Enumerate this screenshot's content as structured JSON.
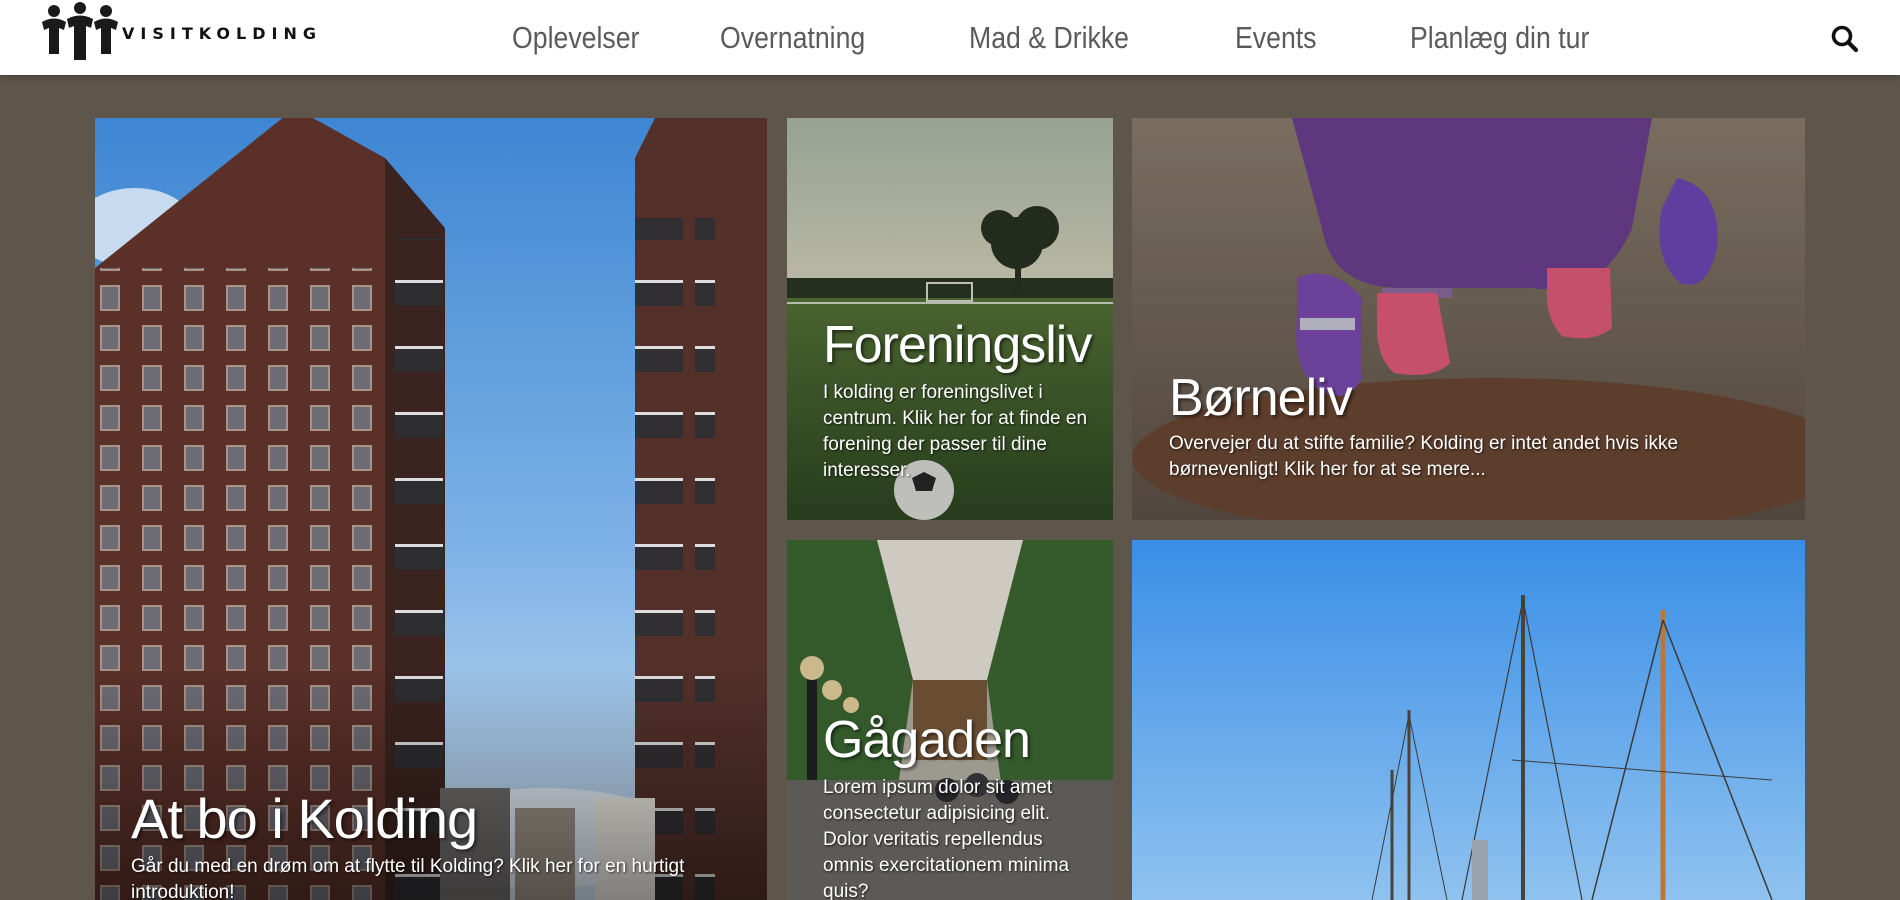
{
  "header": {
    "logo_text": "VISITKOLDING",
    "nav": [
      "Oplevelser",
      "Overnatning",
      "Mad & Drikke",
      "Events",
      "Planlæg din tur"
    ],
    "search_icon": "search-icon"
  },
  "tiles": {
    "bo": {
      "title": "At bo i Kolding",
      "text": "Går du med en drøm om at flytte til Kolding? Klik her for en hurtigt introduktion!"
    },
    "forening": {
      "title": "Foreningsliv",
      "text": "I kolding er foreningslivet i centrum. Klik her for at finde en forening der passer til dine interesser."
    },
    "born": {
      "title": "Børneliv",
      "text": "Overvejer du at stifte familie? Kolding er intet andet hvis ikke børnevenligt! Klik her for at se mere..."
    },
    "gaa": {
      "title": "Gågaden",
      "text": "Lorem ipsum dolor sit amet consectetur adipisicing elit. Dolor veritatis repellendus omnis exercitationem minima quis?"
    },
    "harbor": {
      "title": "",
      "text": ""
    }
  },
  "colors": {
    "page_background": "#5e554b",
    "header_background": "#ffffff",
    "nav_text": "#5b5b5b"
  }
}
